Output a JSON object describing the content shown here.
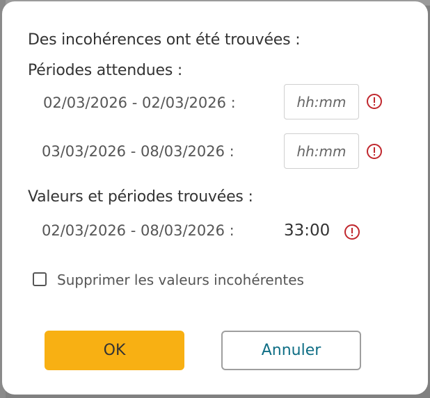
{
  "dialog": {
    "title": "Des incohérences ont été trouvées :",
    "expected_heading": "Périodes attendues :",
    "expected_periods": [
      {
        "label": "02/03/2026 - 02/03/2026 :",
        "input_placeholder": "hh:mm",
        "input_value": ""
      },
      {
        "label": "03/03/2026 - 08/03/2026 :",
        "input_placeholder": "hh:mm",
        "input_value": ""
      }
    ],
    "found_heading": "Valeurs et périodes trouvées :",
    "found_periods": [
      {
        "label": "02/03/2026 - 08/03/2026 :",
        "value": "33:00"
      }
    ],
    "delete_checkbox": {
      "label": "Supprimer les valeurs incohérentes",
      "checked": false
    },
    "ok_button": "OK",
    "cancel_button": "Annuler"
  },
  "colors": {
    "warning": "#c0272d",
    "ok_button_bg": "#f8b013",
    "cancel_text": "#0f6e85"
  },
  "icons": {
    "warning": "exclamation-circle-icon",
    "checkbox": "checkbox-unchecked"
  }
}
